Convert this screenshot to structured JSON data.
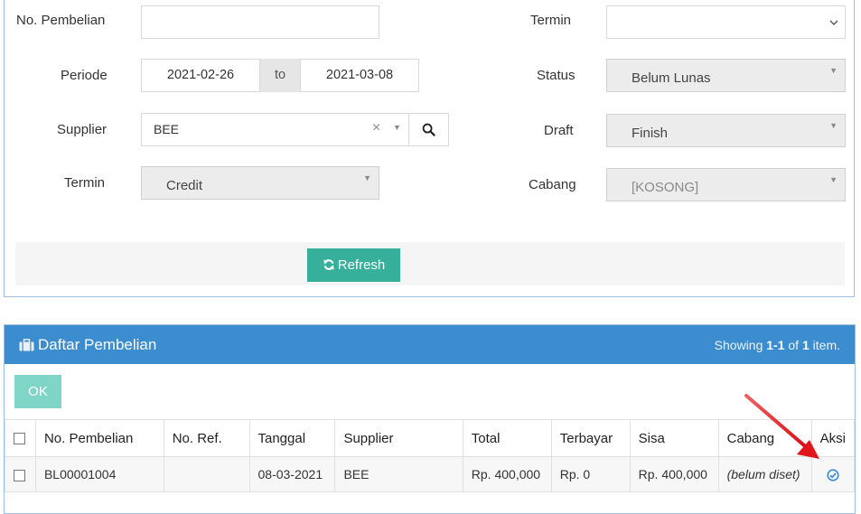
{
  "filter": {
    "no_pembelian": {
      "label": "No. Pembelian",
      "value": ""
    },
    "periode": {
      "label": "Periode",
      "from": "2021-02-26",
      "sep": "to",
      "to": "2021-03-08"
    },
    "supplier": {
      "label": "Supplier",
      "value": "BEE",
      "clear_glyph": "×",
      "caret_glyph": "▼"
    },
    "termin_left": {
      "label": "Termin",
      "value": "Credit"
    },
    "termin_right": {
      "label": "Termin",
      "value": ""
    },
    "status": {
      "label": "Status",
      "value": "Belum Lunas"
    },
    "draft": {
      "label": "Draft",
      "value": "Finish"
    },
    "cabang": {
      "label": "Cabang",
      "value": "[KOSONG]"
    },
    "refresh_label": "Refresh"
  },
  "list": {
    "title": "Daftar Pembelian",
    "showing_prefix": "Showing ",
    "showing_range": "1-1",
    "showing_of": " of ",
    "showing_total": "1",
    "showing_suffix": " item.",
    "ok_label": "OK",
    "columns": [
      "No. Pembelian",
      "No. Ref.",
      "Tanggal",
      "Supplier",
      "Total",
      "Terbayar",
      "Sisa",
      "Cabang",
      "Aksi"
    ],
    "rows": [
      {
        "no_pembelian": "BL00001004",
        "no_ref": "",
        "tanggal": "08-03-2021",
        "supplier": "BEE",
        "total": "Rp. 400,000",
        "terbayar": "Rp. 0",
        "sisa": "Rp. 400,000",
        "cabang": "(belum diset)"
      }
    ]
  },
  "colors": {
    "header_blue": "#3c8dd0",
    "teal_button": "#36b09a",
    "ok_button": "#7fd6c7",
    "annotation_red": "#e0161b"
  },
  "icons": {
    "search": "search-icon",
    "refresh": "refresh-icon",
    "briefcase": "briefcase-icon",
    "aksi": "check-circle-icon"
  }
}
